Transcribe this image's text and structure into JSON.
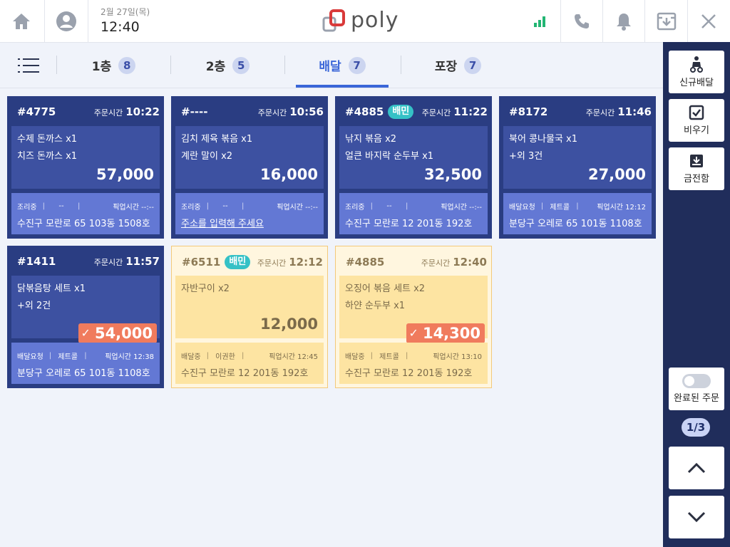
{
  "header": {
    "date": "2월 27일(목)",
    "time": "12:40",
    "logo_text": "poly",
    "brand_color": "#d93a3a",
    "icons": [
      "home-icon",
      "account-icon",
      "signal-icon",
      "phone-icon",
      "bell-icon",
      "download-icon",
      "close-icon"
    ]
  },
  "tabs": [
    {
      "label": "1층",
      "count": "8"
    },
    {
      "label": "2층",
      "count": "5"
    },
    {
      "label": "배달",
      "count": "7"
    },
    {
      "label": "포장",
      "count": "7"
    }
  ],
  "active_tab": "배달",
  "orders": [
    {
      "num": "#4775",
      "baemin": "",
      "time_label": "주문시간",
      "time": "10:22",
      "item1": "수제 돈까스  x1",
      "item2": "치즈 돈까스 x1",
      "price": "57,000",
      "paid": false,
      "status": "조리중",
      "driver": "--",
      "pickup": "픽업시간 --:--",
      "address": "수진구 모란로 65 103동 1508호"
    },
    {
      "num": "#----",
      "baemin": "",
      "time_label": "주문시간",
      "time": "10:56",
      "item1": "김치 제육 볶음  x1",
      "item2": "계란 말이 x2",
      "price": "16,000",
      "paid": false,
      "status": "조리중",
      "driver": "--",
      "pickup": "픽업시간 --:--",
      "address": "주소를 입력해 주세요"
    },
    {
      "num": "#4885",
      "baemin": "배민",
      "time_label": "주문시간",
      "time": "11:22",
      "item1": "낚지 볶음  x2",
      "item2": "얼큰 바지락 순두부 x1",
      "price": "32,500",
      "paid": false,
      "status": "조리중",
      "driver": "--",
      "pickup": "픽업시간 --:--",
      "address": "수진구 모란로 12 201동 192호"
    },
    {
      "num": "#8172",
      "baemin": "",
      "time_label": "주문시간",
      "time": "11:46",
      "item1": "북어 콩나물국  x1",
      "item2": "+외 3건",
      "price": "27,000",
      "paid": false,
      "status": "배달요청",
      "driver": "제트콜",
      "pickup": "픽업시간 12:12",
      "address": "분당구 오레로 65 101동 1108호"
    },
    {
      "num": "#1411",
      "baemin": "",
      "time_label": "주문시간",
      "time": "11:57",
      "item1": "닭볶음탕 세트  x1",
      "item2": "+외 2건",
      "price": "54,000",
      "paid": true,
      "status": "배달요청",
      "driver": "제트콜",
      "pickup": "픽업시간 12:38",
      "address": "분당구 오레로 65 101동 1108호"
    },
    {
      "num": "#6511",
      "baemin": "배민",
      "time_label": "주문시간",
      "time": "12:12",
      "item1": "자반구이  x2",
      "item2": "",
      "price": "12,000",
      "paid": false,
      "status": "배달중",
      "driver": "이권한",
      "pickup": "픽업시간 12:45",
      "address": "수진구 모란로 12 201동 192호"
    },
    {
      "num": "#4885",
      "baemin": "",
      "time_label": "주문시간",
      "time": "12:40",
      "item1": "오징어 볶음 세트  x2",
      "item2": "하얀 순두부 x1",
      "price": "14,300",
      "paid": true,
      "status": "배달중",
      "driver": "제트콜",
      "pickup": "픽업시간 13:10",
      "address": "수진구 모란로 12 201동 192호"
    }
  ],
  "sidebar": {
    "new_delivery": "신규배달",
    "clear": "비우기",
    "cash_drawer": "금전함",
    "completed_orders": "완료된 주문",
    "page": "1/3"
  }
}
